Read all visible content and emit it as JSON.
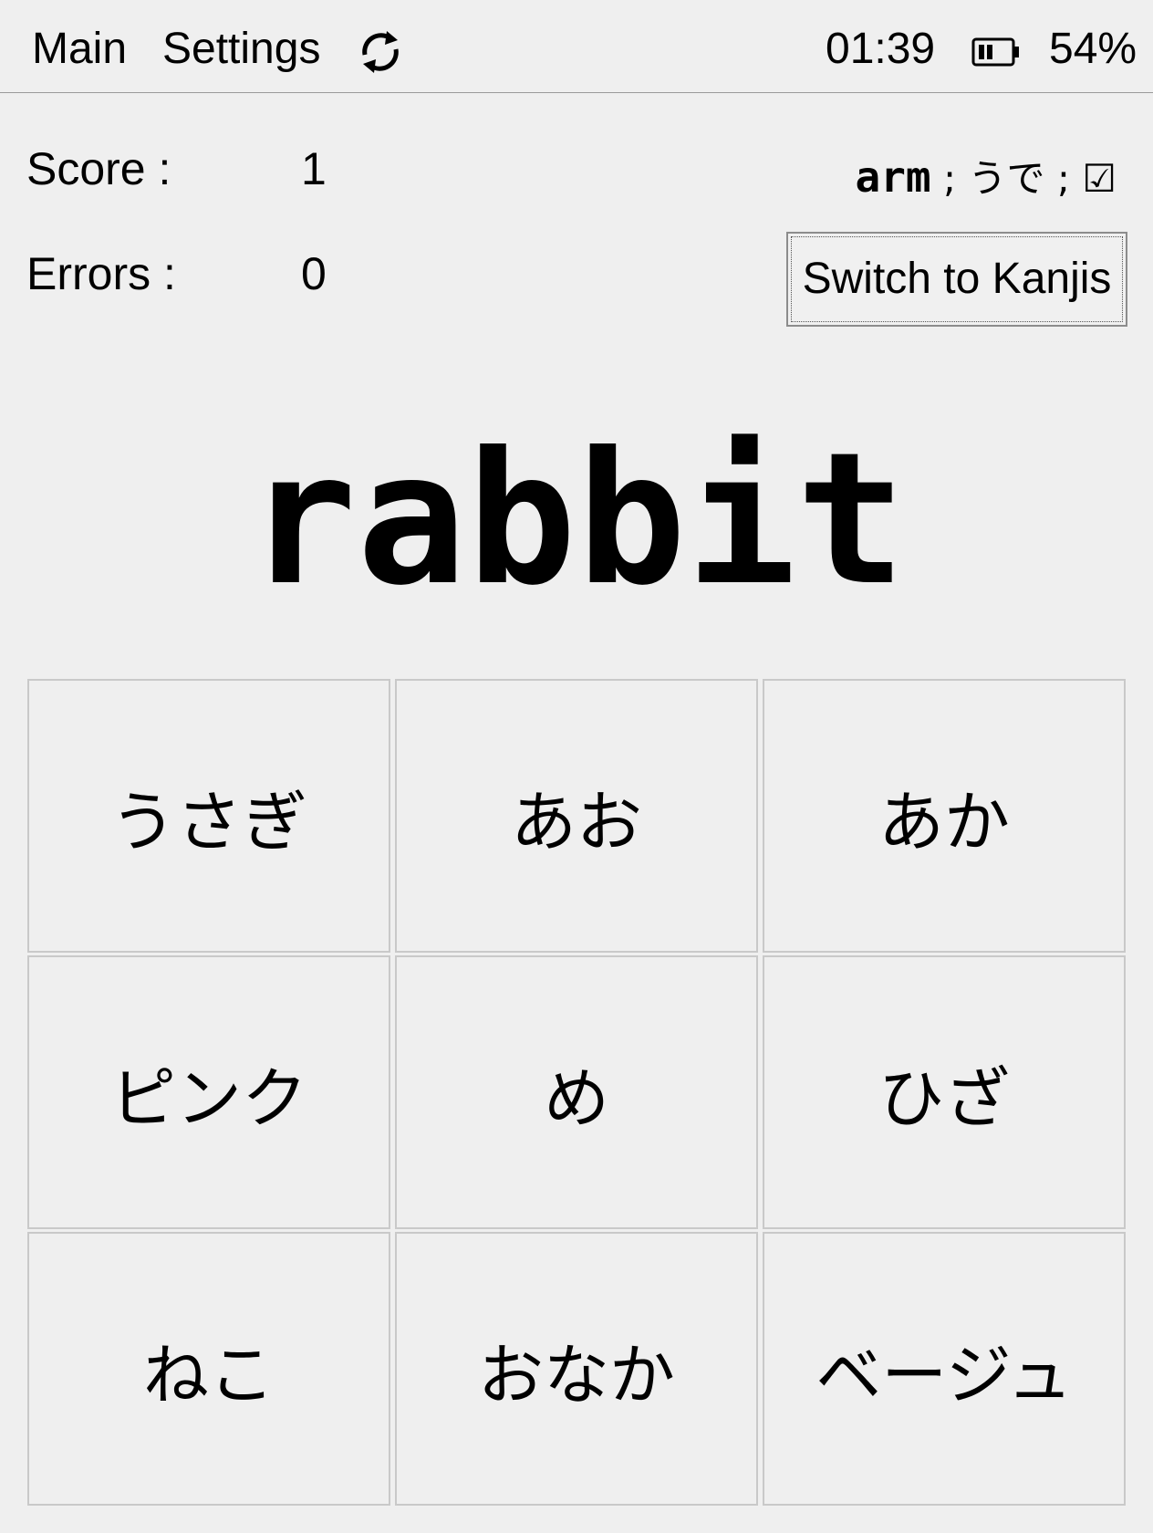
{
  "topbar": {
    "menu_main": "Main",
    "menu_settings": "Settings",
    "refresh_icon": "refresh-icon",
    "clock": "01:39",
    "battery_icon": "battery-icon",
    "battery_percent": "54%"
  },
  "stats": {
    "score_label": "Score :",
    "score_value": "1",
    "errors_label": "Errors :",
    "errors_value": "0"
  },
  "last_answer": {
    "word": "arm",
    "rest": " ; うで ; ☑"
  },
  "switch_button_label": "Switch to Kanjis",
  "question": "rabbit",
  "choices": [
    "うさぎ",
    "あお",
    "あか",
    "ピンク",
    "め",
    "ひざ",
    "ねこ",
    "おなか",
    "ベージュ"
  ]
}
